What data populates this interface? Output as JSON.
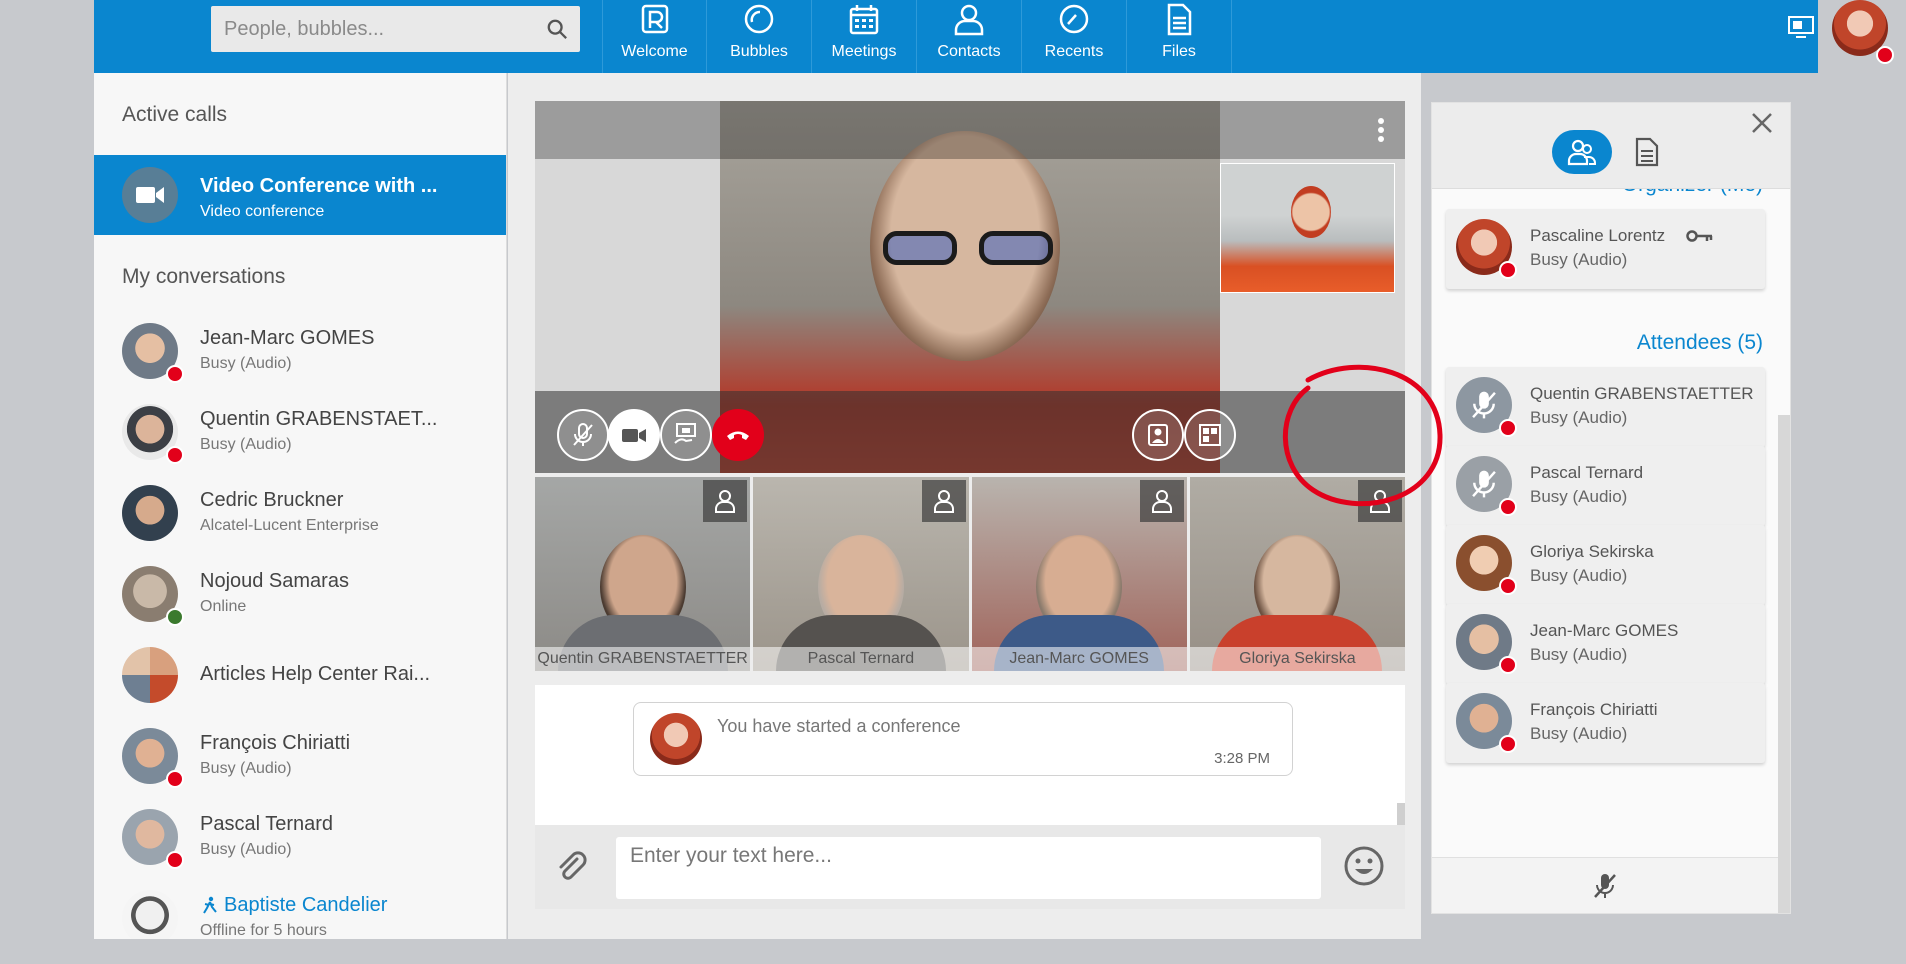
{
  "header": {
    "search_placeholder": "People, bubbles...",
    "tabs": [
      {
        "label": "Welcome",
        "icon": "rainbow-logo-icon"
      },
      {
        "label": "Bubbles",
        "icon": "bubbles-icon"
      },
      {
        "label": "Meetings",
        "icon": "calendar-icon"
      },
      {
        "label": "Contacts",
        "icon": "person-icon"
      },
      {
        "label": "Recents",
        "icon": "clock-icon"
      },
      {
        "label": "Files",
        "icon": "file-icon"
      }
    ],
    "accent_color": "#0a86cf",
    "busy_color": "#e2001a"
  },
  "left": {
    "active_calls_title": "Active calls",
    "active_call": {
      "name": "Video Conference with ...",
      "status": "Video conference"
    },
    "my_conversations_title": "My conversations",
    "conversations": [
      {
        "name": "Jean-Marc GOMES",
        "status": "Busy (Audio)",
        "presence": "busy"
      },
      {
        "name": "Quentin GRABENSTAET...",
        "status": "Busy (Audio)",
        "presence": "busy"
      },
      {
        "name": "Cedric Bruckner",
        "status": "Alcatel-Lucent Enterprise",
        "presence": "none"
      },
      {
        "name": "Nojoud Samaras",
        "status": "Online",
        "presence": "online"
      },
      {
        "name": "Articles Help Center Rai...",
        "status": "",
        "presence": "none"
      },
      {
        "name": "François Chiriatti",
        "status": "Busy (Audio)",
        "presence": "busy"
      },
      {
        "name": "Pascal Ternard",
        "status": "Busy (Audio)",
        "presence": "busy"
      },
      {
        "name": "Baptiste Candelier",
        "status": "Offline for 5 hours",
        "presence": "none"
      }
    ]
  },
  "video": {
    "thumbnails": [
      {
        "name": "Quentin GRABENSTAETTER"
      },
      {
        "name": "Pascal Ternard"
      },
      {
        "name": "Jean-Marc GOMES"
      },
      {
        "name": "Gloriya Sekirska"
      }
    ]
  },
  "chat": {
    "message_text": "You have started a conference",
    "message_time": "3:28 PM",
    "input_placeholder": "Enter your text here..."
  },
  "right": {
    "organizer_title": "Organizer (Me)",
    "organizer": {
      "name": "Pascaline Lorentz",
      "status": "Busy (Audio)"
    },
    "attendees_title": "Attendees (5)",
    "attendees": [
      {
        "name": "Quentin GRABENSTAETTER",
        "status": "Busy (Audio)"
      },
      {
        "name": "Pascal Ternard",
        "status": "Busy (Audio)"
      },
      {
        "name": "Gloriya Sekirska",
        "status": "Busy (Audio)"
      },
      {
        "name": "Jean-Marc GOMES",
        "status": "Busy (Audio)"
      },
      {
        "name": "François Chiriatti",
        "status": "Busy (Audio)"
      }
    ]
  }
}
